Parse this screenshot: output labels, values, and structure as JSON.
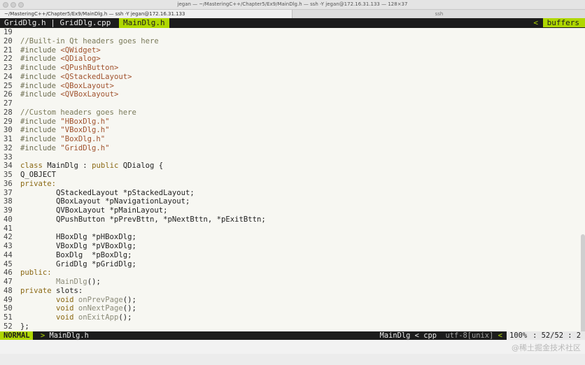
{
  "window": {
    "title": "jegan — ~/MasteringC++/Chapter5/Ex9/MainDlg.h — ssh -Y jegan@172.16.31.133 — 128×37"
  },
  "terminal_tabs": [
    {
      "label": "~/MasteringC++/Chapter5/Ex9/MainDlg.h — ssh -Y jegan@172.16.31.133",
      "active": true
    },
    {
      "label": "ssh",
      "active": false
    }
  ],
  "buffer_line": {
    "inactive": "GridDlg.h | GridDlg.cpp",
    "active": "MainDlg.h",
    "right_arrow": "<",
    "right_label": "buffers"
  },
  "editor": {
    "lines": [
      {
        "n": "19",
        "segs": []
      },
      {
        "n": "20",
        "segs": [
          {
            "t": "//Built-in Qt headers goes here",
            "c": "comment"
          }
        ]
      },
      {
        "n": "21",
        "segs": [
          {
            "t": "#include ",
            "c": "pre"
          },
          {
            "t": "<QWidget>",
            "c": "str"
          }
        ]
      },
      {
        "n": "22",
        "segs": [
          {
            "t": "#include ",
            "c": "pre"
          },
          {
            "t": "<QDialog>",
            "c": "str"
          }
        ]
      },
      {
        "n": "23",
        "segs": [
          {
            "t": "#include ",
            "c": "pre"
          },
          {
            "t": "<QPushButton>",
            "c": "str"
          }
        ]
      },
      {
        "n": "24",
        "segs": [
          {
            "t": "#include ",
            "c": "pre"
          },
          {
            "t": "<QStackedLayout>",
            "c": "str"
          }
        ]
      },
      {
        "n": "25",
        "segs": [
          {
            "t": "#include ",
            "c": "pre"
          },
          {
            "t": "<QBoxLayout>",
            "c": "str"
          }
        ]
      },
      {
        "n": "26",
        "segs": [
          {
            "t": "#include ",
            "c": "pre"
          },
          {
            "t": "<QVBoxLayout>",
            "c": "str"
          }
        ]
      },
      {
        "n": "27",
        "segs": []
      },
      {
        "n": "28",
        "segs": [
          {
            "t": "//Custom headers goes here",
            "c": "comment"
          }
        ]
      },
      {
        "n": "29",
        "segs": [
          {
            "t": "#include ",
            "c": "pre"
          },
          {
            "t": "\"HBoxDlg.h\"",
            "c": "str"
          }
        ]
      },
      {
        "n": "30",
        "segs": [
          {
            "t": "#include ",
            "c": "pre"
          },
          {
            "t": "\"VBoxDlg.h\"",
            "c": "str"
          }
        ]
      },
      {
        "n": "31",
        "segs": [
          {
            "t": "#include ",
            "c": "pre"
          },
          {
            "t": "\"BoxDlg.h\"",
            "c": "str"
          }
        ]
      },
      {
        "n": "32",
        "segs": [
          {
            "t": "#include ",
            "c": "pre"
          },
          {
            "t": "\"GridDlg.h\"",
            "c": "str"
          }
        ]
      },
      {
        "n": "33",
        "segs": []
      },
      {
        "n": "34",
        "segs": [
          {
            "t": "class ",
            "c": "kw"
          },
          {
            "t": "MainDlg : ",
            "c": "type"
          },
          {
            "t": "public ",
            "c": "kw"
          },
          {
            "t": "QDialog {",
            "c": "type"
          }
        ]
      },
      {
        "n": "35",
        "segs": [
          {
            "t": "Q_OBJECT",
            "c": "macro"
          }
        ]
      },
      {
        "n": "36",
        "segs": [
          {
            "t": "private:",
            "c": "kw"
          }
        ]
      },
      {
        "n": "37",
        "segs": [
          {
            "t": "        QStackedLayout *pStackedLayout;",
            "c": "type"
          }
        ]
      },
      {
        "n": "38",
        "segs": [
          {
            "t": "        QBoxLayout *pNavigationLayout;",
            "c": "type"
          }
        ]
      },
      {
        "n": "39",
        "segs": [
          {
            "t": "        QVBoxLayout *pMainLayout;",
            "c": "type"
          }
        ]
      },
      {
        "n": "40",
        "segs": [
          {
            "t": "        QPushButton *pPrevBttn, *pNextBttn, *pExitBttn;",
            "c": "type"
          }
        ]
      },
      {
        "n": "41",
        "segs": []
      },
      {
        "n": "42",
        "segs": [
          {
            "t": "        HBoxDlg *pHBoxDlg;",
            "c": "type"
          }
        ]
      },
      {
        "n": "43",
        "segs": [
          {
            "t": "        VBoxDlg *pVBoxDlg;",
            "c": "type"
          }
        ]
      },
      {
        "n": "44",
        "segs": [
          {
            "t": "        BoxDlg  *pBoxDlg;",
            "c": "type"
          }
        ]
      },
      {
        "n": "45",
        "segs": [
          {
            "t": "        GridDlg *pGridDlg;",
            "c": "type"
          }
        ]
      },
      {
        "n": "46",
        "segs": [
          {
            "t": "public:",
            "c": "kw"
          }
        ]
      },
      {
        "n": "47",
        "segs": [
          {
            "t": "        ",
            "c": "type"
          },
          {
            "t": "MainDlg",
            "c": "fn"
          },
          {
            "t": "();",
            "c": "type"
          }
        ]
      },
      {
        "n": "48",
        "segs": [
          {
            "t": "private ",
            "c": "kw"
          },
          {
            "t": "slots:",
            "c": "type"
          }
        ]
      },
      {
        "n": "49",
        "segs": [
          {
            "t": "        ",
            "c": "type"
          },
          {
            "t": "void ",
            "c": "kw"
          },
          {
            "t": "onPrevPage",
            "c": "fn"
          },
          {
            "t": "();",
            "c": "type"
          }
        ]
      },
      {
        "n": "50",
        "segs": [
          {
            "t": "        ",
            "c": "type"
          },
          {
            "t": "void ",
            "c": "kw"
          },
          {
            "t": "onNextPage",
            "c": "fn"
          },
          {
            "t": "();",
            "c": "type"
          }
        ]
      },
      {
        "n": "51",
        "segs": [
          {
            "t": "        ",
            "c": "type"
          },
          {
            "t": "void ",
            "c": "kw"
          },
          {
            "t": "onExitApp",
            "c": "fn"
          },
          {
            "t": "();",
            "c": "type"
          }
        ]
      },
      {
        "n": "52",
        "segs": [
          {
            "t": "}",
            "c": "cursor"
          },
          {
            "t": ";",
            "c": "type"
          }
        ]
      }
    ]
  },
  "statusline": {
    "mode": "NORMAL",
    "sep": ">",
    "file": "MainDlg.h",
    "tag": "MainDlg < cpp",
    "encoding": "utf-8[unix]",
    "arrow": "<",
    "percent": "100%",
    "colon": ":",
    "position": "52/52 :",
    "col": "2"
  },
  "watermark": "@稀土掘金技术社区"
}
